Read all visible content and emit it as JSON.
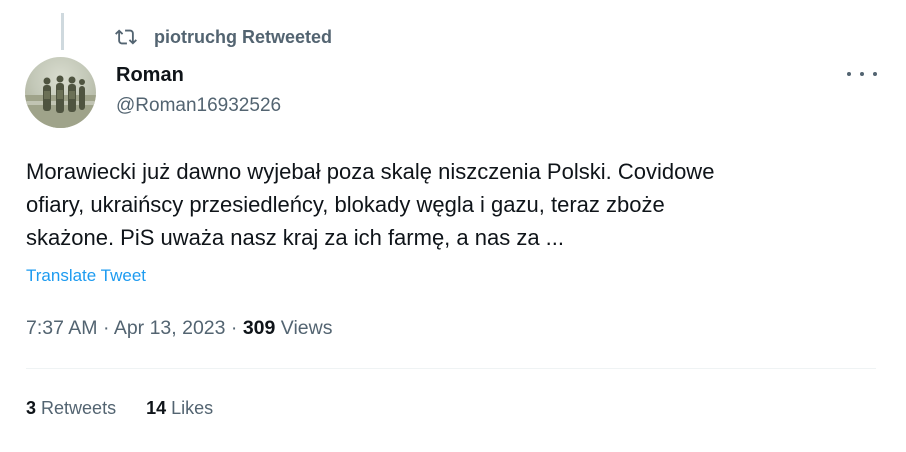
{
  "retweet": {
    "user": "piotruchg",
    "label": "Retweeted"
  },
  "author": {
    "name": "Roman",
    "handle": "@Roman16932526"
  },
  "tweet": {
    "text": "Morawiecki już dawno wyjebał poza skalę niszczenia Polski.  Covidowe\nofiary, ukraińscy przesiedleńcy, blokady węgla i gazu, teraz zboże\nskażone.  PiS uważa nasz kraj za ich farmę, a nas za ..."
  },
  "translate_label": "Translate Tweet",
  "meta": {
    "time": "7:37 AM",
    "sep1": "·",
    "date": "Apr 13, 2023",
    "sep2": "·",
    "views_count": "309",
    "views_label": "Views"
  },
  "stats": {
    "retweets_count": "3",
    "retweets_label": "Retweets",
    "likes_count": "14",
    "likes_label": "Likes"
  },
  "colors": {
    "primary_text": "#0f1419",
    "secondary_text": "#536471",
    "link": "#1d9bf0",
    "divider": "#eff3f4"
  }
}
